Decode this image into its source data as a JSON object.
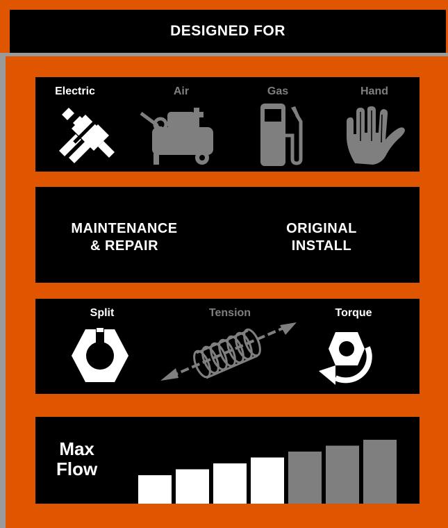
{
  "header": {
    "title": "DESIGNED FOR"
  },
  "power": [
    {
      "label": "Electric",
      "icon": "electric-plug-icon",
      "active": true
    },
    {
      "label": "Air",
      "icon": "air-compressor-icon",
      "active": false
    },
    {
      "label": "Gas",
      "icon": "gas-pump-icon",
      "active": false
    },
    {
      "label": "Hand",
      "icon": "hand-icon",
      "active": false
    }
  ],
  "application": [
    {
      "line1": "MAINTENANCE",
      "line2": "& REPAIR"
    },
    {
      "line1": "ORIGINAL",
      "line2": "INSTALL"
    }
  ],
  "methods": [
    {
      "label": "Split",
      "icon": "split-nut-icon",
      "active": true
    },
    {
      "label": "Tension",
      "icon": "tension-spring-icon",
      "active": false
    },
    {
      "label": "Torque",
      "icon": "torque-nut-icon",
      "active": true
    }
  ],
  "max_flow": {
    "line1": "Max",
    "line2": "Flow",
    "level": 4,
    "total": 7,
    "colors": {
      "active": "#ffffff",
      "inactive": "#7f7f7f"
    }
  },
  "colors": {
    "brand": "#e05600",
    "panel": "#000000",
    "inactive": "#7f7f7f"
  }
}
